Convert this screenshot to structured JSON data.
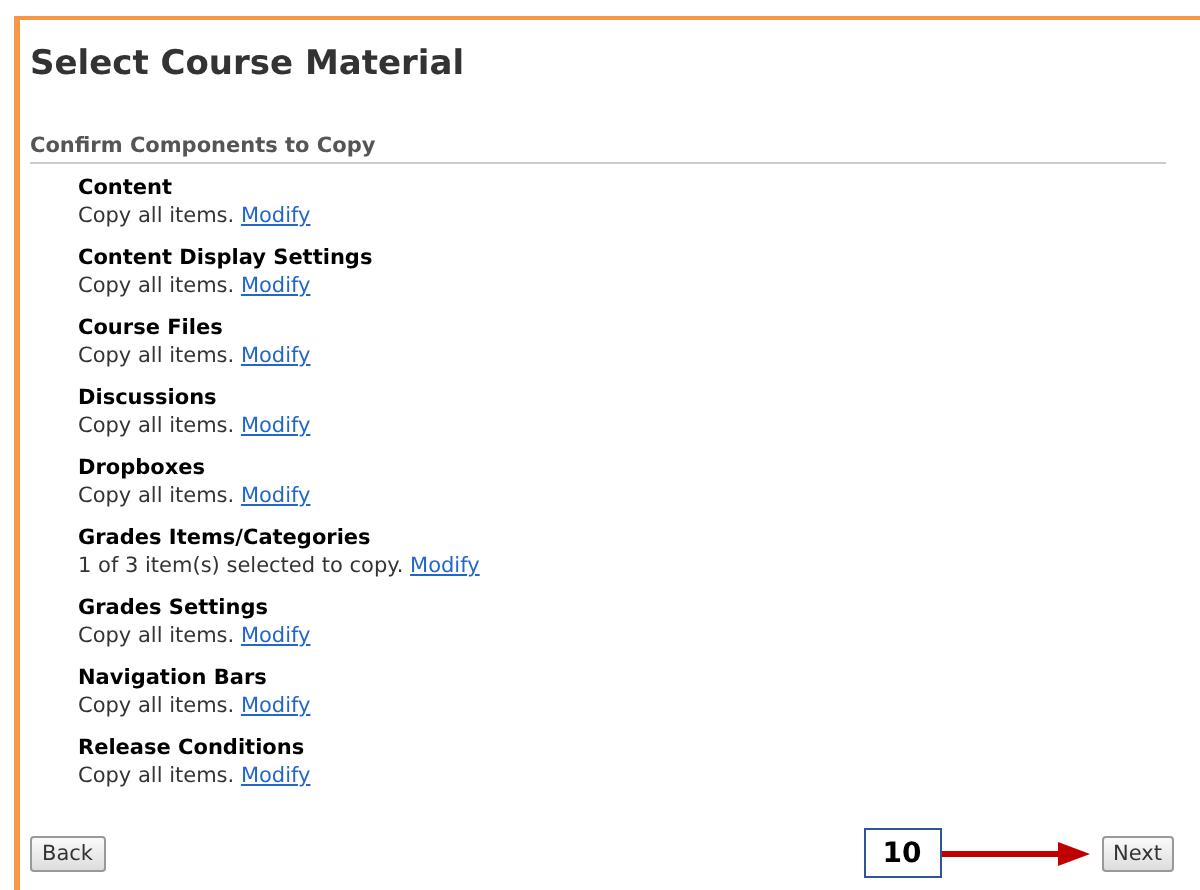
{
  "page_title": "Select Course Material",
  "section_title": "Confirm Components to Copy",
  "components": [
    {
      "name": "Content",
      "summary": "Copy all items.",
      "link": "Modify"
    },
    {
      "name": "Content Display Settings",
      "summary": "Copy all items.",
      "link": "Modify"
    },
    {
      "name": "Course Files",
      "summary": "Copy all items.",
      "link": "Modify"
    },
    {
      "name": "Discussions",
      "summary": "Copy all items.",
      "link": "Modify"
    },
    {
      "name": "Dropboxes",
      "summary": "Copy all items.",
      "link": "Modify"
    },
    {
      "name": "Grades Items/Categories",
      "summary": "1 of 3 item(s) selected to copy.",
      "link": "Modify"
    },
    {
      "name": "Grades Settings",
      "summary": "Copy all items.",
      "link": "Modify"
    },
    {
      "name": "Navigation Bars",
      "summary": "Copy all items.",
      "link": "Modify"
    },
    {
      "name": "Release Conditions",
      "summary": "Copy all items.",
      "link": "Modify"
    }
  ],
  "buttons": {
    "back": "Back",
    "next": "Next"
  },
  "callout": {
    "step": "10"
  }
}
